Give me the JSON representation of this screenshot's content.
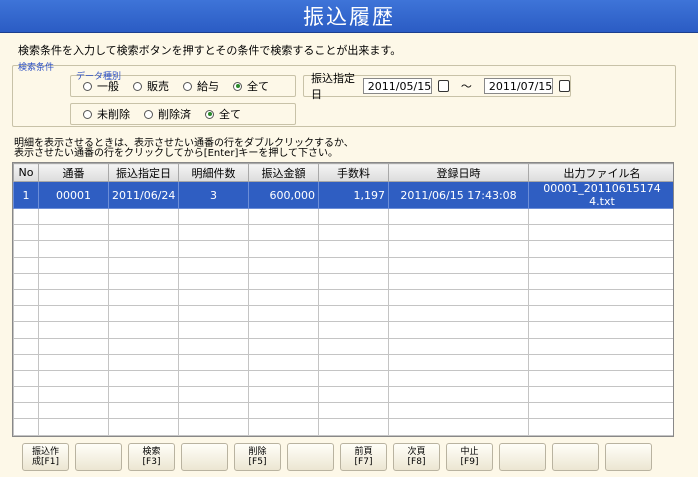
{
  "title": "振込履歴",
  "instructions": "検索条件を入力して検索ボタンを押すとその条件で検索することが出来ます。",
  "search": {
    "label": "検索条件",
    "data_type_label": "データ種別",
    "type_options": [
      {
        "label": "一般",
        "selected": false
      },
      {
        "label": "販売",
        "selected": false
      },
      {
        "label": "給与",
        "selected": false
      },
      {
        "label": "全て",
        "selected": true
      }
    ],
    "delete_options": [
      {
        "label": "未削除",
        "selected": false
      },
      {
        "label": "削除済",
        "selected": false
      },
      {
        "label": "全て",
        "selected": true
      }
    ],
    "date_label": "振込指定日",
    "date_from": "2011/05/15",
    "date_to": "2011/07/15",
    "tilde": "～"
  },
  "hint_lines": [
    "明細を表示させるときは、表示させたい通番の行をダブルクリックするか、",
    "表示させたい通番の行をクリックしてから[Enter]キーを押して下さい。"
  ],
  "table": {
    "columns": [
      "No",
      "通番",
      "振込指定日",
      "明細件数",
      "振込金額",
      "手数料",
      "登録日時",
      "出力ファイル名"
    ],
    "rows": [
      [
        "1",
        "00001",
        "2011/06/24",
        "3",
        "600,000",
        "1,197",
        "2011/06/15 17:43:08",
        "00001_20110615174​4.txt"
      ]
    ]
  },
  "footer_buttons": [
    {
      "line1": "振込作",
      "line2": "成[F1]"
    },
    {
      "line1": "",
      "line2": ""
    },
    {
      "line1": "検索",
      "line2": "[F3]"
    },
    {
      "line1": "",
      "line2": ""
    },
    {
      "line1": "削除",
      "line2": "[F5]"
    },
    {
      "line1": "",
      "line2": ""
    },
    {
      "line1": "前頁",
      "line2": "[F7]"
    },
    {
      "line1": "次頁",
      "line2": "[F8]"
    },
    {
      "line1": "中止",
      "line2": "[F9]"
    },
    {
      "line1": "",
      "line2": ""
    },
    {
      "line1": "",
      "line2": ""
    },
    {
      "line1": "",
      "line2": ""
    }
  ]
}
